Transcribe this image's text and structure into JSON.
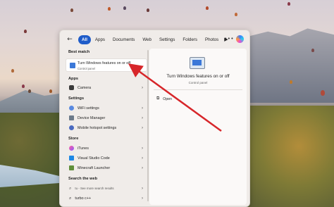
{
  "topbar": {
    "filters": [
      "All",
      "Apps",
      "Documents",
      "Web",
      "Settings",
      "Folders",
      "Photos"
    ],
    "more": "▶",
    "dots": "•••"
  },
  "best_match": {
    "heading": "Best match",
    "title": "Turn Windows features on or off",
    "subtitle": "Control panel"
  },
  "apps": {
    "heading": "Apps",
    "items": [
      {
        "label": "Camera"
      }
    ]
  },
  "settings": {
    "heading": "Settings",
    "items": [
      {
        "label": "WiFi settings"
      },
      {
        "label": "Device Manager"
      },
      {
        "label": "Mobile hotspot settings"
      }
    ]
  },
  "store": {
    "heading": "Store",
    "items": [
      {
        "label": "iTunes"
      },
      {
        "label": "Visual Studio Code"
      },
      {
        "label": "Minecraft Launcher"
      }
    ]
  },
  "web": {
    "heading": "Search the web",
    "items": [
      {
        "label": "tu - See more search results"
      },
      {
        "label": "turbo c++"
      }
    ]
  },
  "detail": {
    "title": "Turn Windows features on or off",
    "subtitle": "Control panel",
    "open_label": "Open"
  },
  "colors": {
    "accent": "#1f5cc9",
    "arrow": "#d7262a"
  }
}
